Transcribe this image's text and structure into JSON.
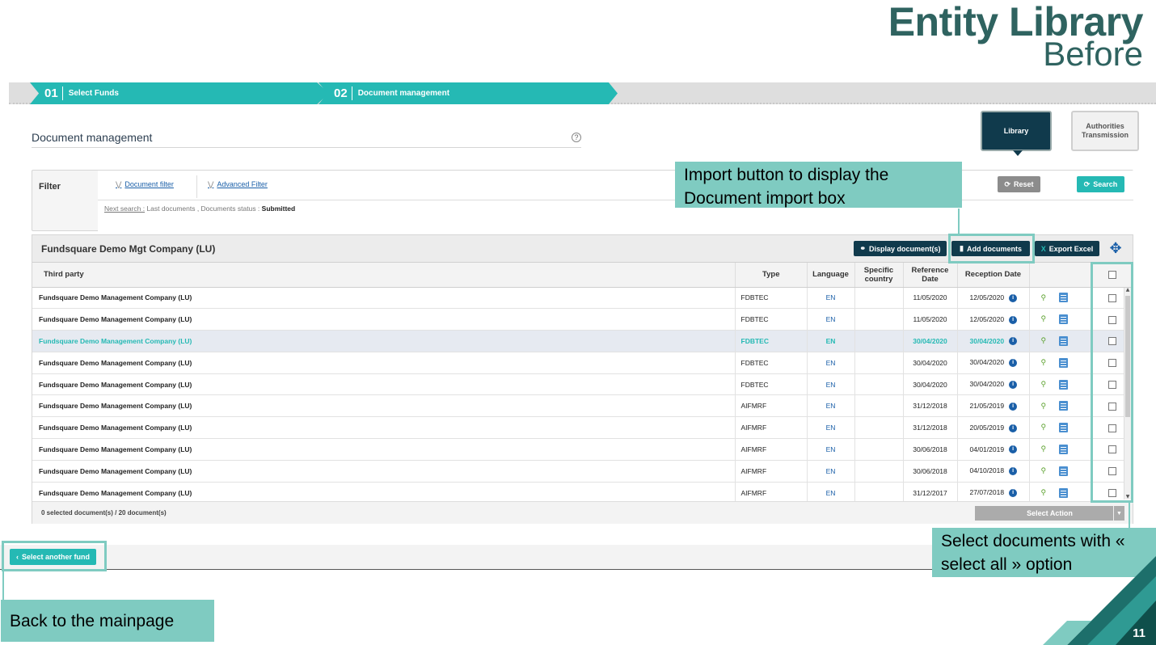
{
  "slide": {
    "title": "Entity Library",
    "subtitle": "Before",
    "page_number": "11"
  },
  "steps": [
    {
      "num": "01",
      "label": "Select Funds"
    },
    {
      "num": "02",
      "label": "Document management"
    }
  ],
  "page": {
    "heading": "Document management",
    "help_icon": "?"
  },
  "tiles": {
    "library": "Library",
    "authorities": "Authorities Transmission"
  },
  "filter": {
    "label": "Filter",
    "tabs": [
      "Document filter",
      "Advanced Filter"
    ],
    "next_search_link": "Next search :",
    "next_search_text": "Last documents   , Documents status :",
    "next_search_value": "Submitted",
    "reset_label": "Reset",
    "search_label": "Search"
  },
  "results": {
    "title": "Fundsquare Demo Mgt Company (LU)",
    "display_label": "Display document(s)",
    "add_label": "Add documents",
    "export_label": "Export Excel",
    "export_icon": "X",
    "columns": [
      "Third party",
      "Type",
      "Language",
      "Specific country",
      "Reference Date",
      "Reception Date"
    ],
    "rows": [
      {
        "party": "Fundsquare Demo Management Company (LU)",
        "type": "FDBTEC",
        "lang": "EN",
        "country": "",
        "ref": "11/05/2020",
        "rec": "12/05/2020"
      },
      {
        "party": "Fundsquare Demo Management Company (LU)",
        "type": "FDBTEC",
        "lang": "EN",
        "country": "",
        "ref": "11/05/2020",
        "rec": "12/05/2020"
      },
      {
        "party": "Fundsquare Demo Management Company (LU)",
        "type": "FDBTEC",
        "lang": "EN",
        "country": "",
        "ref": "30/04/2020",
        "rec": "30/04/2020"
      },
      {
        "party": "Fundsquare Demo Management Company (LU)",
        "type": "FDBTEC",
        "lang": "EN",
        "country": "",
        "ref": "30/04/2020",
        "rec": "30/04/2020"
      },
      {
        "party": "Fundsquare Demo Management Company (LU)",
        "type": "FDBTEC",
        "lang": "EN",
        "country": "",
        "ref": "30/04/2020",
        "rec": "30/04/2020"
      },
      {
        "party": "Fundsquare Demo Management Company (LU)",
        "type": "AIFMRF",
        "lang": "EN",
        "country": "",
        "ref": "31/12/2018",
        "rec": "21/05/2019"
      },
      {
        "party": "Fundsquare Demo Management Company (LU)",
        "type": "AIFMRF",
        "lang": "EN",
        "country": "",
        "ref": "31/12/2018",
        "rec": "20/05/2019"
      },
      {
        "party": "Fundsquare Demo Management Company (LU)",
        "type": "AIFMRF",
        "lang": "EN",
        "country": "",
        "ref": "30/06/2018",
        "rec": "04/01/2019"
      },
      {
        "party": "Fundsquare Demo Management Company (LU)",
        "type": "AIFMRF",
        "lang": "EN",
        "country": "",
        "ref": "30/06/2018",
        "rec": "04/10/2018"
      },
      {
        "party": "Fundsquare Demo Management Company (LU)",
        "type": "AIFMRF",
        "lang": "EN",
        "country": "",
        "ref": "31/12/2017",
        "rec": "27/07/2018"
      }
    ],
    "selected_count": "0 selected document(s) / 20 document(s)",
    "select_action": "Select Action",
    "info_glyph": "i"
  },
  "bottom": {
    "another_fund": "Select another fund"
  },
  "callouts": {
    "import": "Import button to display the Document import box",
    "select_all": "Select documents with « select all » option",
    "back": "Back to the mainpage"
  },
  "colors": {
    "teal": "#25b9b4",
    "navy": "#103a4c",
    "callout": "#7fcbc1",
    "title": "#2f6360"
  },
  "icons": [
    "help-icon",
    "reset-icon",
    "search-icon",
    "display-icon",
    "add-document-icon",
    "excel-icon",
    "move-icon",
    "magnifier-icon",
    "document-icon",
    "info-icon",
    "chevron-left-icon",
    "dropdown-icon"
  ]
}
